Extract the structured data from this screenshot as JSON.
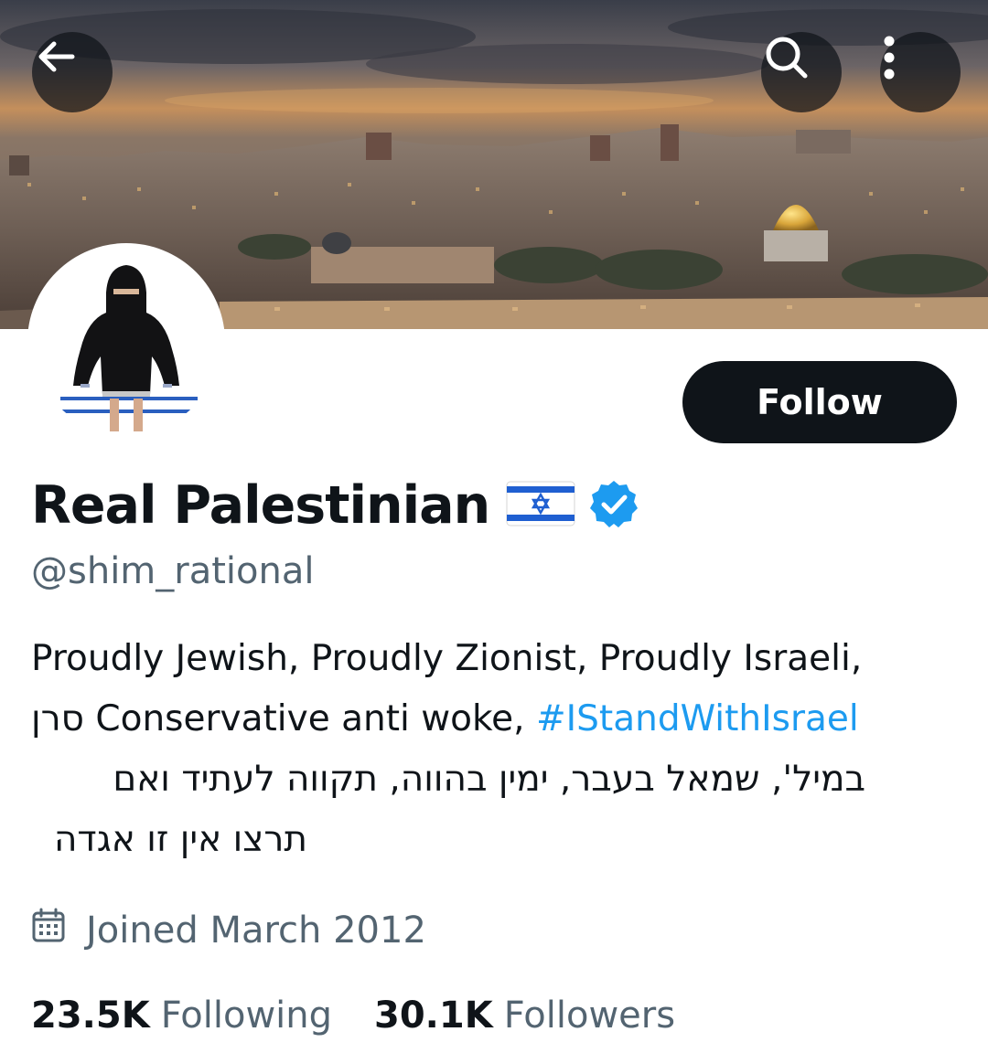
{
  "header": {
    "back_icon": "arrow-left-icon",
    "search_icon": "search-icon",
    "more_icon": "more-vertical-icon"
  },
  "profile": {
    "display_name": "Real Palestinian",
    "flag_icon": "israel-flag-icon",
    "verified_icon": "verified-badge-icon",
    "handle": "@shim_rational",
    "follow_label": "Follow",
    "bio": {
      "line1": "Proudly Jewish, Proudly Zionist, Proudly Israeli,",
      "line2_hebrew": "סרן",
      "line2_text": " Conservative anti woke, ",
      "hashtag": "#IStandWithIsrael",
      "line3": "במיל', שמאל בעבר, ימין בהווה, תקווה לעתיד ואם",
      "line4": "תרצו אין זו אגדה"
    },
    "joined": "Joined March 2012",
    "stats": {
      "following_count": "23.5K",
      "following_label": "Following",
      "followers_count": "30.1K",
      "followers_label": "Followers"
    }
  },
  "colors": {
    "text_primary": "#0f1419",
    "text_secondary": "#536471",
    "accent": "#1d9bf0",
    "button_bg": "#0f1419"
  }
}
